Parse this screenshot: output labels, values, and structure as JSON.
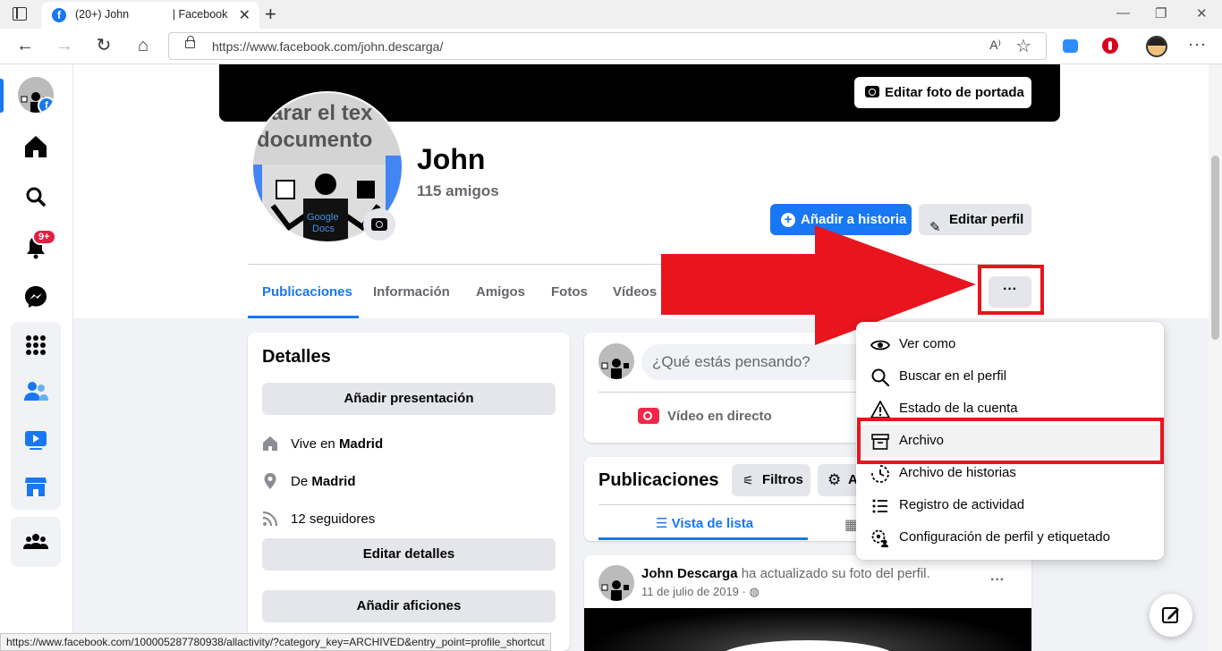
{
  "browser": {
    "tab_title": "(20+) John              | Facebook",
    "url": "https://www.facebook.com/john.descarga/",
    "read_aloud": "A⁾",
    "status_url": "https://www.facebook.com/100005287780938/allactivity/?category_key=ARCHIVED&entry_point=profile_shortcut"
  },
  "rail": {
    "notifications_badge": "9+"
  },
  "profile": {
    "cover_button": "Editar foto de portada",
    "name": "John",
    "friends": "115 amigos",
    "add_story": "Añadir a historia",
    "edit_profile": "Editar perfil",
    "avatar_text_line1": "arar el tex",
    "avatar_text_line2": "documento",
    "avatar_logo_line1": "Google",
    "avatar_logo_line2": "Docs"
  },
  "tabs": [
    "Publicaciones",
    "Información",
    "Amigos",
    "Fotos",
    "Vídeos"
  ],
  "more_button": "···",
  "details": {
    "title": "Detalles",
    "add_bio": "Añadir presentación",
    "lives_prefix": "Vive en ",
    "lives_city": "Madrid",
    "from_prefix": "De ",
    "from_city": "Madrid",
    "followers": "12 seguidores",
    "edit_details": "Editar detalles",
    "add_hobbies": "Añadir aficiones"
  },
  "composer": {
    "placeholder": "¿Qué estás pensando?",
    "live_video": "Vídeo en directo"
  },
  "posts": {
    "title": "Publicaciones",
    "filters": "Filtros",
    "manage": "A",
    "list_view": "Vista de lista",
    "author": "John Descarga",
    "action": " ha actualizado su foto del perfil.",
    "date": "11 de julio de 2019 · "
  },
  "dropdown": {
    "items": [
      {
        "label": "Ver como",
        "icon": "eye-icon"
      },
      {
        "label": "Buscar en el perfil",
        "icon": "search-icon"
      },
      {
        "label": "Estado de la cuenta",
        "icon": "warning-icon"
      },
      {
        "label": "Archivo",
        "icon": "archive-icon"
      },
      {
        "label": "Archivo de historias",
        "icon": "story-archive-icon"
      },
      {
        "label": "Registro de actividad",
        "icon": "list-icon"
      },
      {
        "label": "Configuración de perfil y etiquetado",
        "icon": "settings-user-icon"
      }
    ]
  },
  "colors": {
    "brand": "#1877f2",
    "highlight": "#e8141e",
    "badge": "#e41e3f"
  }
}
